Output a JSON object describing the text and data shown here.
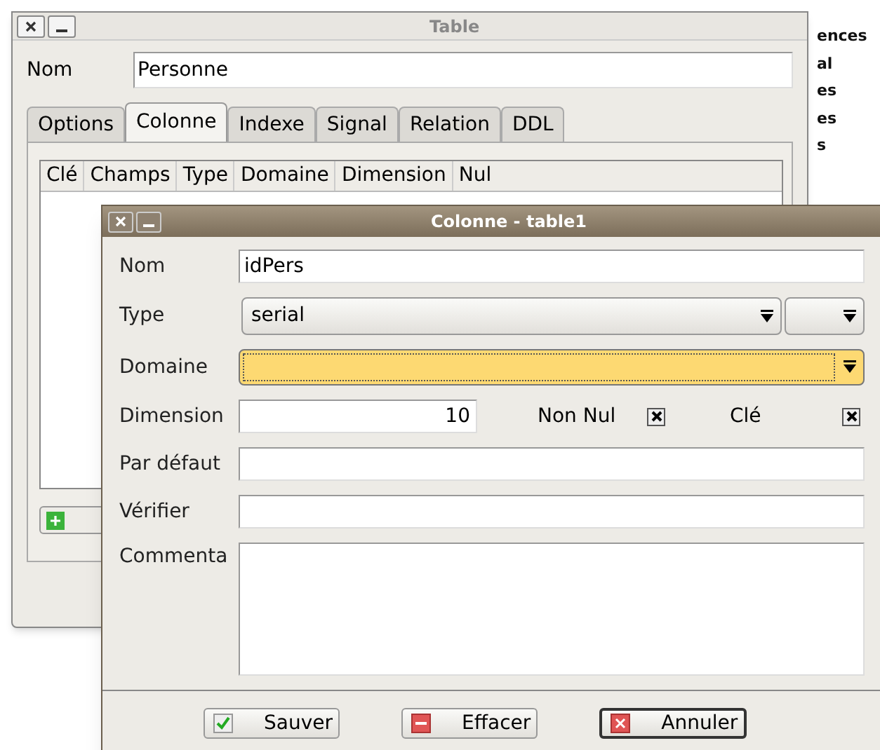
{
  "background_list": [
    "ences",
    "al",
    "es",
    "es",
    "s"
  ],
  "table_window": {
    "title": "Table",
    "name_label": "Nom",
    "name_value": "Personne",
    "tabs": [
      {
        "label": "Options",
        "selected": false
      },
      {
        "label": "Colonne",
        "selected": true
      },
      {
        "label": "Indexe",
        "selected": false
      },
      {
        "label": "Signal",
        "selected": false
      },
      {
        "label": "Relation",
        "selected": false
      },
      {
        "label": "DDL",
        "selected": false
      }
    ],
    "columns": [
      "Clé",
      "Champs",
      "Type",
      "Domaine",
      "Dimension",
      "Nul"
    ]
  },
  "dialog": {
    "title": "Colonne - table1",
    "nom": {
      "label": "Nom",
      "value": "idPers"
    },
    "type": {
      "label": "Type",
      "value": "serial"
    },
    "domaine": {
      "label": "Domaine",
      "focused": true
    },
    "dimension": {
      "label": "Dimension",
      "value": "10"
    },
    "non_nul": {
      "label": "Non Nul",
      "checked": true
    },
    "cle": {
      "label": "Clé",
      "checked": true
    },
    "defaut": {
      "label": "Par défaut"
    },
    "verifier": {
      "label": "Vérifier"
    },
    "commentaire": {
      "label": "Commenta"
    },
    "buttons": [
      {
        "label": "Sauver",
        "kind": "save",
        "default": false
      },
      {
        "label": "Effacer",
        "kind": "clear",
        "default": false
      },
      {
        "label": "Annuler",
        "kind": "cancel",
        "default": true
      }
    ]
  }
}
